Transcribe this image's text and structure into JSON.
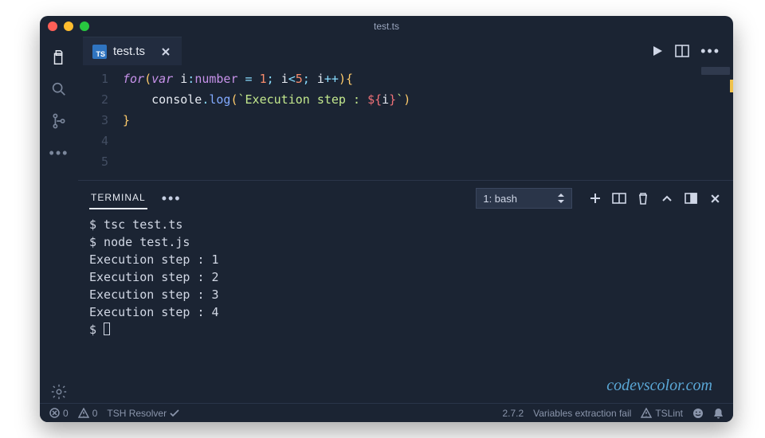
{
  "window": {
    "title": "test.ts"
  },
  "tabs": {
    "active": {
      "filename": "test.ts",
      "language_badge": "TS"
    }
  },
  "editor": {
    "lines": [
      {
        "n": "1",
        "segments": [
          {
            "t": "for",
            "c": "kw"
          },
          {
            "t": "(",
            "c": "brace"
          },
          {
            "t": "var ",
            "c": "kw"
          },
          {
            "t": "i",
            "c": "ident"
          },
          {
            "t": ":",
            "c": "op"
          },
          {
            "t": "number",
            "c": "type"
          },
          {
            "t": " = ",
            "c": "op"
          },
          {
            "t": "1",
            "c": "num"
          },
          {
            "t": "; ",
            "c": "op"
          },
          {
            "t": "i",
            "c": "ident"
          },
          {
            "t": "<",
            "c": "op"
          },
          {
            "t": "5",
            "c": "num"
          },
          {
            "t": "; ",
            "c": "op"
          },
          {
            "t": "i",
            "c": "ident"
          },
          {
            "t": "++",
            "c": "op"
          },
          {
            "t": ")",
            "c": "brace"
          },
          {
            "t": "{",
            "c": "brace"
          }
        ]
      },
      {
        "n": "2",
        "indent": "    ",
        "segments": [
          {
            "t": "console",
            "c": "obj"
          },
          {
            "t": ".",
            "c": "op"
          },
          {
            "t": "log",
            "c": "fn"
          },
          {
            "t": "(",
            "c": "brace"
          },
          {
            "t": "`Execution step : ",
            "c": "str"
          },
          {
            "t": "${",
            "c": "interp"
          },
          {
            "t": "i",
            "c": "ident"
          },
          {
            "t": "}",
            "c": "interp"
          },
          {
            "t": "`",
            "c": "str"
          },
          {
            "t": ")",
            "c": "brace"
          }
        ]
      },
      {
        "n": "3",
        "segments": [
          {
            "t": "}",
            "c": "brace"
          }
        ]
      },
      {
        "n": "4",
        "segments": []
      },
      {
        "n": "5",
        "segments": []
      }
    ]
  },
  "panel": {
    "active_tab": "TERMINAL",
    "shell_selector": "1: bash"
  },
  "terminal": {
    "prompt": "$",
    "lines": [
      "$ tsc test.ts",
      "$ node test.js",
      "Execution step : 1",
      "Execution step : 2",
      "Execution step : 3",
      "Execution step : 4"
    ]
  },
  "statusbar": {
    "errors": "0",
    "warnings": "0",
    "resolver": "TSH Resolver",
    "version": "2.7.2",
    "message": "Variables extraction fail",
    "linter": "TSLint"
  },
  "watermark": "codevscolor.com"
}
